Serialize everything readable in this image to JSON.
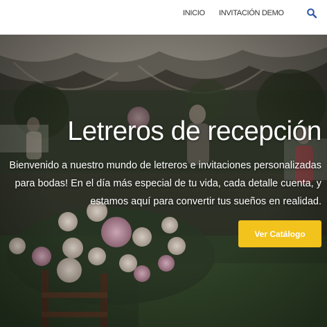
{
  "nav": {
    "items": [
      {
        "label": "INICIO"
      },
      {
        "label": "INVITACIÓN DEMO"
      }
    ],
    "search_icon": "search-icon",
    "accent_color": "#2b56a8"
  },
  "hero": {
    "title": "Letreros de recepción",
    "description": "Bienvenido a nuestro mundo de letreros e invitaciones personalizadas para bodas! En el día más especial de tu vida, cada detalle cuenta, y estamos aquí para convertir tus sueños en realidad.",
    "cta_label": "Ver Catálogo",
    "cta_color": "#f2c21d"
  }
}
